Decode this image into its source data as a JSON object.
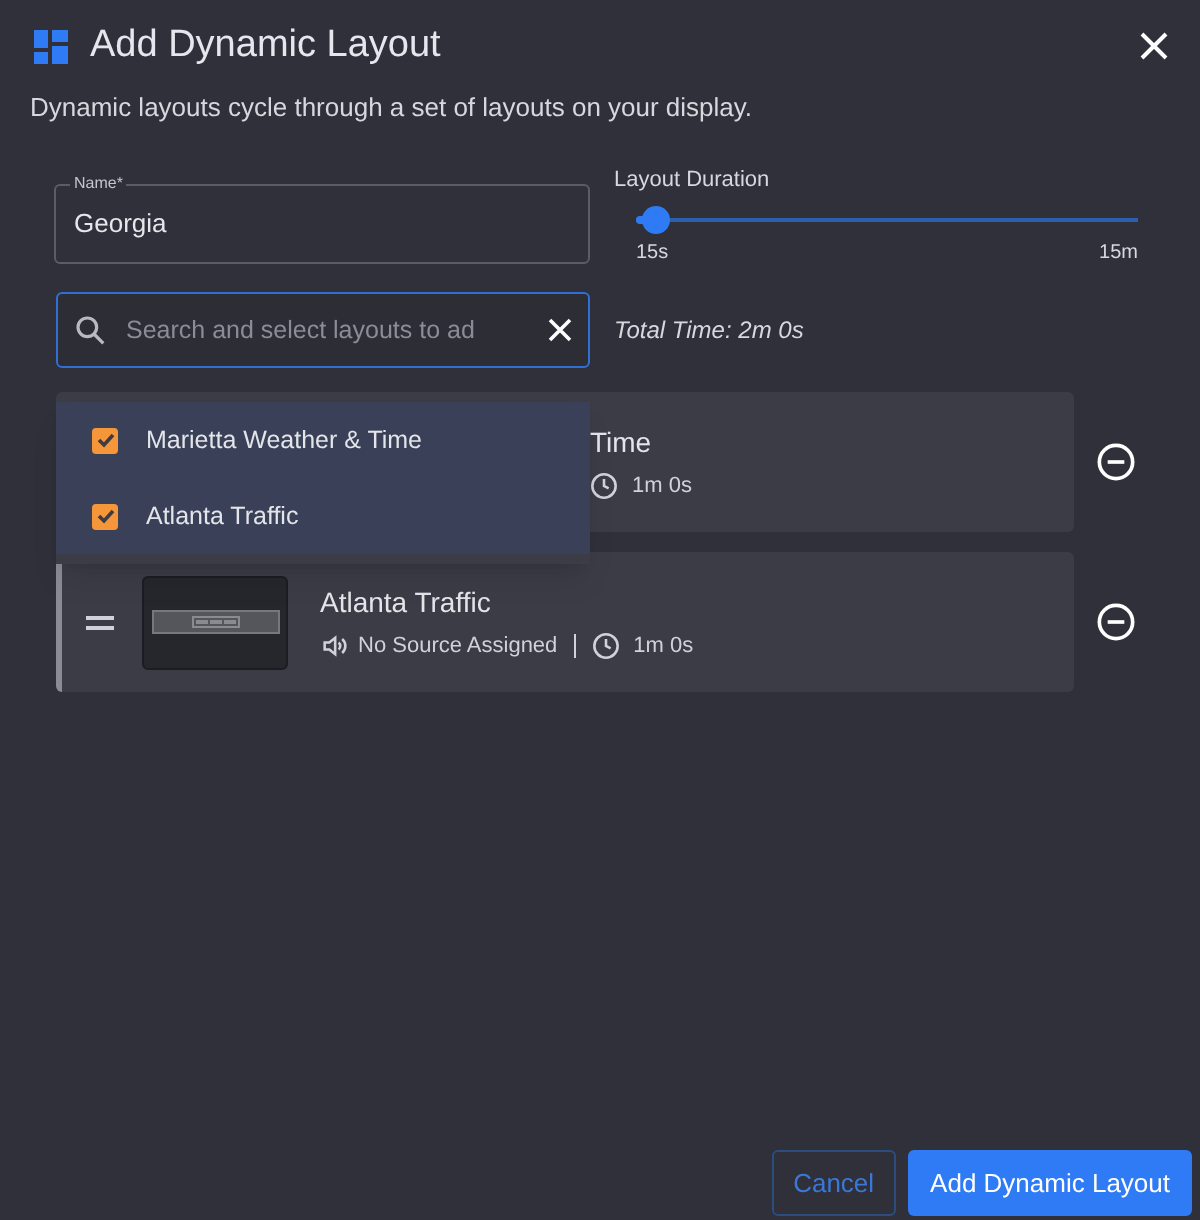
{
  "dialog": {
    "title": "Add Dynamic Layout",
    "description": "Dynamic layouts cycle through a set of layouts on your display."
  },
  "name_field": {
    "label": "Name",
    "required_mark": "*",
    "value": "Georgia"
  },
  "duration": {
    "label": "Layout Duration",
    "level": 0.04,
    "min_label": "15s",
    "max_label": "15m"
  },
  "search": {
    "placeholder": "Search and select layouts to ad"
  },
  "total_time": "Total Time: 2m 0s",
  "options": [
    {
      "label": "Marietta Weather & Time",
      "checked": true
    },
    {
      "label": "Atlanta Traffic",
      "checked": true
    }
  ],
  "layouts": [
    {
      "kind": "covered",
      "title": "Time",
      "duration": "1m 0s"
    },
    {
      "kind": "full",
      "title": "Atlanta Traffic",
      "source": "No Source Assigned",
      "duration": "1m 0s"
    }
  ],
  "buttons": [
    {
      "label": "Cancel",
      "kind": "outline"
    },
    {
      "label": "Add Dynamic Layout",
      "kind": "primary"
    }
  ]
}
